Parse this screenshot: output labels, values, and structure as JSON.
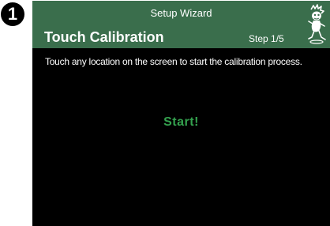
{
  "step_marker": "1",
  "header": {
    "wizard_title": "Setup Wizard",
    "page_title": "Touch Calibration",
    "step": "Step 1/5",
    "mascot_icon": "cartoon-mascot-icon",
    "background_color": "#3a6e4c"
  },
  "content": {
    "instruction": "Touch any location on the screen to start the calibration process.",
    "start_label": "Start!",
    "start_color": "#34a14e"
  }
}
